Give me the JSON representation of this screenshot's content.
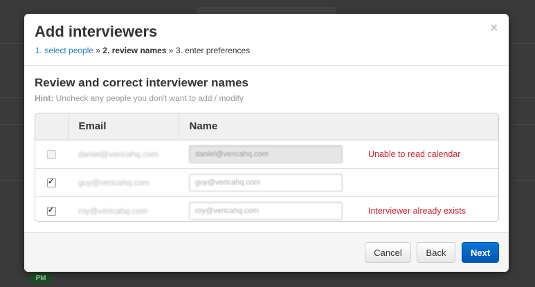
{
  "background": {
    "pill_label": "PM"
  },
  "modal": {
    "title": "Add interviewers",
    "close_symbol": "×",
    "steps": {
      "step1": "1. select people",
      "sep1": " » ",
      "step2": "2. review names",
      "sep2": " » ",
      "step3": "3. enter preferences"
    },
    "section_title": "Review and correct interviewer names",
    "hint_label": "Hint:",
    "hint_text": " Uncheck any people you don't want to add / modify",
    "table": {
      "headers": {
        "email": "Email",
        "name": "Name"
      },
      "rows": [
        {
          "checked": false,
          "disabled": true,
          "email": "daniel@vericahq.com",
          "name": "daniel@vericahq.com",
          "status": "Unable to read calendar"
        },
        {
          "checked": true,
          "disabled": false,
          "email": "guy@vericahq.com",
          "name": "guy@vericahq.com",
          "status": ""
        },
        {
          "checked": true,
          "disabled": false,
          "email": "roy@vericahq.com",
          "name": "roy@vericahq.com",
          "status": "Interviewer already exists"
        }
      ]
    },
    "footer": {
      "cancel": "Cancel",
      "back": "Back",
      "next": "Next"
    }
  },
  "colors": {
    "link": "#2a7cc4",
    "error": "#d4222a",
    "primary": "#0a77d5"
  }
}
